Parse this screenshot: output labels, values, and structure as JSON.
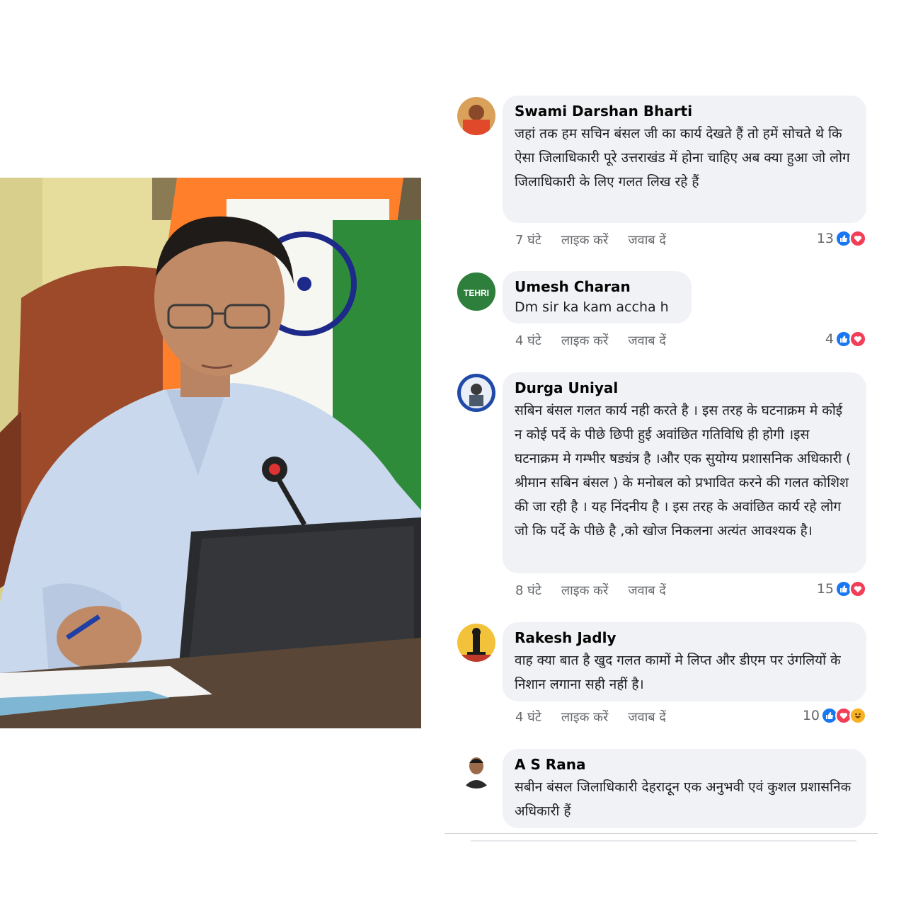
{
  "comments": [
    {
      "author": "Swami Darshan Bharti",
      "text": "जहां तक हम सचिन बंसल जी का कार्य देखते हैं तो हमें सोचते थे कि ऐसा जिलाधिकारी पूरे उत्तराखंड में होना चाहिए अब क्या हुआ जो लोग जिलाधिकारी के लिए गलत लिख रहे हैं",
      "time": "7 घंटे",
      "like_label": "लाइक करें",
      "reply_label": "जवाब दें",
      "reaction_count": "13",
      "reactions": [
        "like-icon",
        "love-icon"
      ]
    },
    {
      "author": "Umesh Charan",
      "avatar_text": "TEHRI",
      "text": "Dm sir ka kam accha h",
      "time": "4 घंटे",
      "like_label": "लाइक करें",
      "reply_label": "जवाब दें",
      "reaction_count": "4",
      "reactions": [
        "like-icon",
        "love-icon"
      ]
    },
    {
      "author": "Durga Uniyal",
      "text": "सबिन बंसल  गलत कार्य नही करते है । इस तरह के घटनाक्रम मे कोई न कोई पर्दे के पीछे छिपी हुई अवांछित गतिविधि ही  होगी ।इस घटनाक्रम मे गम्भीर षड्यंत्र है ।और एक सुयोग्य प्रशासनिक अधिकारी ( श्रीमान सबिन बंसल ) के मनोबल को प्रभावित करने की गलत कोशिश की जा रही है । यह निंदनीय है । इस तरह के अवांछित कार्य रहे लोग जो कि पर्दे के पीछे है ,को खोज निकलना अत्यंत आवश्यक है।",
      "time": "8 घंटे",
      "like_label": "लाइक करें",
      "reply_label": "जवाब दें",
      "reaction_count": "15",
      "reactions": [
        "like-icon",
        "love-icon"
      ]
    },
    {
      "author": "Rakesh Jadly",
      "text": "वाह क्या बात है खुद गलत कामों मे लिप्त और डीएम पर उंगलियों के निशान लगाना सही नहीं है।",
      "time": "4 घंटे",
      "like_label": "लाइक करें",
      "reply_label": "जवाब दें",
      "reaction_count": "10",
      "reactions": [
        "like-icon",
        "love-icon",
        "haha-icon"
      ]
    },
    {
      "author": "A S Rana",
      "text": "सबीन बंसल जिलाधिकारी देहरादून एक अनुभवी एवं कुशल प्रशासनिक  अधिकारी हैं"
    }
  ]
}
